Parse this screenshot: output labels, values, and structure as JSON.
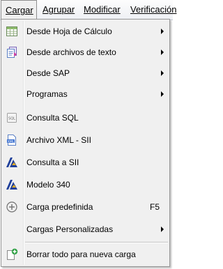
{
  "menubar": {
    "items": [
      "Cargar",
      "Agrupar",
      "Modificar",
      "Verificación"
    ]
  },
  "menu": {
    "items": [
      {
        "label": "Desde Hoja de Cálculo",
        "icon": "spreadsheet-icon",
        "submenu": true
      },
      {
        "label": "Desde archivos de texto",
        "icon": "text-files-icon",
        "submenu": true
      },
      {
        "label": "Desde SAP",
        "icon": "",
        "submenu": true
      },
      {
        "label": "Programas",
        "icon": "",
        "submenu": true
      },
      {
        "label": "Consulta SQL",
        "icon": "sql-icon",
        "submenu": false
      },
      {
        "label": "Archivo XML - SII",
        "icon": "xml-icon",
        "submenu": false
      },
      {
        "label": "Consulta a SII",
        "icon": "aeat-logo-icon",
        "submenu": false
      },
      {
        "label": "Modelo 340",
        "icon": "aeat-logo-icon",
        "submenu": false
      },
      {
        "label": "Carga predefinida",
        "icon": "add-circle-icon",
        "submenu": false,
        "shortcut": "F5"
      },
      {
        "label": "Cargas Personalizadas",
        "icon": "",
        "submenu": true
      },
      {
        "label": "Borrar todo para nueva carga",
        "icon": "new-document-icon",
        "submenu": false
      }
    ]
  }
}
